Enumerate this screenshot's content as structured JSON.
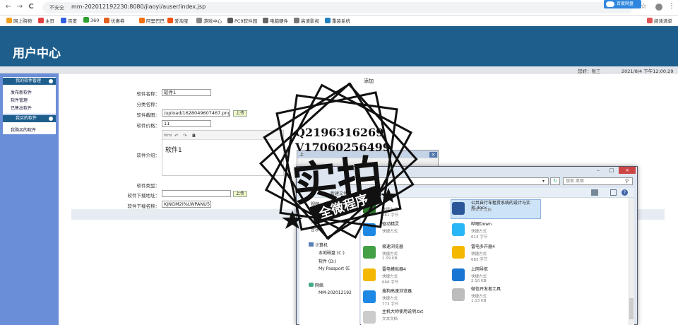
{
  "browser": {
    "back_glyph": "←",
    "forward_glyph": "→",
    "reload_glyph": "C",
    "home_glyph": "⌂",
    "insecure_label": "不安全",
    "url": "mm-202012192230:8080/jiaoyi/auser/index.jsp",
    "extension_label": "百度网盘",
    "bookmarks": [
      {
        "label": "网上购物",
        "color": "#f0a020"
      },
      {
        "label": "主页",
        "color": "#e04040"
      },
      {
        "label": "百度",
        "color": "#3060e0"
      },
      {
        "label": "360",
        "color": "#30a030"
      },
      {
        "label": "优惠券",
        "color": "#e06020"
      },
      {
        "label": "阿里巴巴",
        "color": "#f07010"
      },
      {
        "label": "爱淘宝",
        "color": "#f05010"
      },
      {
        "label": "游戏中心",
        "color": "#888888"
      },
      {
        "label": "PC9软件园",
        "color": "#555555"
      },
      {
        "label": "电脑硬件",
        "color": "#666666"
      },
      {
        "label": "高清影视",
        "color": "#777777"
      },
      {
        "label": "重装系统",
        "color": "#2080c0"
      }
    ],
    "reading_list": "阅读清单"
  },
  "header": {
    "title": "用户中心"
  },
  "infobar": {
    "greeting": "您好：张三",
    "datetime": "2021/8/4 下午12:00:29"
  },
  "sidebar": {
    "sections": [
      {
        "title": "我的软件管理",
        "items": [
          "发布新软件",
          "软件管理",
          "已售出软件"
        ]
      },
      {
        "title": "我买的软件",
        "items": [
          "我购买的软件"
        ]
      }
    ]
  },
  "form": {
    "title": "添加",
    "name_label": "软件名称：",
    "name_value": "软件1",
    "category_label": "分类名称：",
    "screenshot_label": "软件截图：",
    "screenshot_value": "/upload/1628049607467.png",
    "upload_label": "上传",
    "price_label": "软件价格：",
    "price_value": "11",
    "intro_label": "软件介绍：",
    "intro_value": "软件1",
    "editor_tools": [
      "html",
      "↶",
      "↷",
      "B"
    ],
    "type_label": "软件类型：",
    "download_label": "软件下载地址：",
    "download_value": "",
    "download_upload_label": "上传",
    "download_name_label": "软件下载名称：",
    "download_name_value": "KJNGM2I%LWPANU5"
  },
  "explorer": {
    "bgwin_title": "上",
    "search_placeholder": "搜索 桌面",
    "newfolder": "新建文件夹",
    "tree": [
      "视频",
      "图片",
      "文档",
      "音乐",
      "计算机",
      "本地磁盘 (C:)",
      "软件 (D:)",
      "My Passport (E",
      "网络",
      "MM-202012192"
    ],
    "files": [
      {
        "name": "",
        "sub1": "快捷方式",
        "sub2": "661 字节",
        "color": "#2a7a2a"
      },
      {
        "name": "公共自行车租赁系统的设计与实现.docx",
        "sub1": "DOCX 文档",
        "sub2": "",
        "color": "#2b579a"
      },
      {
        "name": "驱动精灵",
        "sub1": "快捷方式",
        "sub2": "",
        "color": "#1e88e5"
      },
      {
        "name": "哔哩Down",
        "sub1": "快捷方式",
        "sub2": "613 字节",
        "color": "#29b6f6"
      },
      {
        "name": "极速浏览器",
        "sub1": "快捷方式",
        "sub2": "1.09 KB",
        "color": "#43a047"
      },
      {
        "name": "雷电多开器4",
        "sub1": "快捷方式",
        "sub2": "683 字节",
        "color": "#f5b800"
      },
      {
        "name": "雷电模拟器4",
        "sub1": "快捷方式",
        "sub2": "668 字节",
        "color": "#f5b800"
      },
      {
        "name": "上网导航",
        "sub1": "快捷方式",
        "sub2": "2.10 KB",
        "color": "#1976d2"
      },
      {
        "name": "搜狗高速浏览器",
        "sub1": "快捷方式",
        "sub2": "773 字节",
        "color": "#1e88e5"
      },
      {
        "name": "微信开发者工具",
        "sub1": "快捷方式",
        "sub2": "1.13 KB",
        "color": "#bdbdbd"
      },
      {
        "name": "主机大师使用说明.txt",
        "sub1": "文本文档",
        "sub2": "",
        "color": "#cccccc"
      }
    ]
  },
  "watermark": {
    "line1": "Q2196316269",
    "line2": "V17060256499",
    "main": "实拍",
    "banner": "全微程序"
  }
}
